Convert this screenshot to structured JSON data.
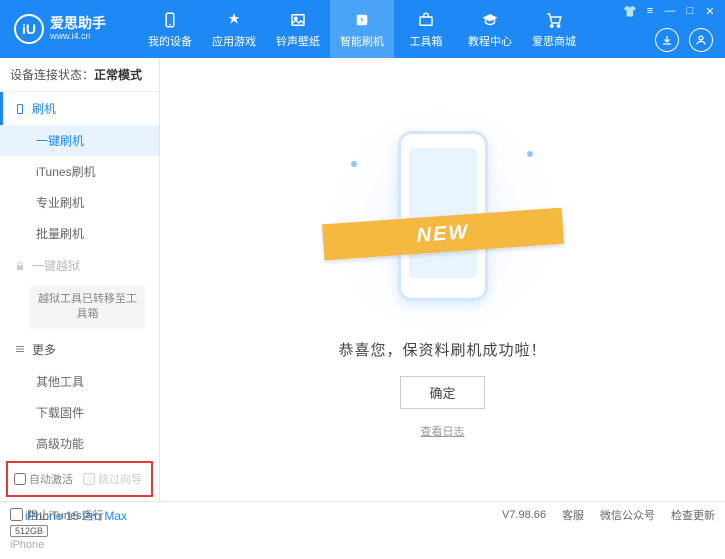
{
  "logo": {
    "mark": "iU",
    "title": "爱思助手",
    "subtitle": "www.i4.cn"
  },
  "nav": [
    {
      "label": "我的设备"
    },
    {
      "label": "应用游戏"
    },
    {
      "label": "铃声壁纸"
    },
    {
      "label": "智能刷机"
    },
    {
      "label": "工具箱"
    },
    {
      "label": "教程中心"
    },
    {
      "label": "爱思商城"
    }
  ],
  "status": {
    "prefix": "设备连接状态：",
    "value": "正常模式"
  },
  "sidebar": {
    "section_flash": "刷机",
    "items_flash": [
      "一键刷机",
      "iTunes刷机",
      "专业刷机",
      "批量刷机"
    ],
    "section_jailbreak": "一键越狱",
    "jailbreak_note": "越狱工具已转移至工具箱",
    "section_more": "更多",
    "items_more": [
      "其他工具",
      "下载固件",
      "高级功能"
    ]
  },
  "checkboxes": {
    "auto_activate": "自动激活",
    "skip_guide": "跳过向导"
  },
  "device": {
    "name": "iPhone 15 Pro Max",
    "storage": "512GB",
    "type": "iPhone"
  },
  "main": {
    "banner": "NEW",
    "success": "恭喜您，保资料刷机成功啦！",
    "ok": "确定",
    "view_log": "查看日志"
  },
  "footer": {
    "block_itunes": "阻止iTunes运行",
    "version": "V7.98.66",
    "links": [
      "客服",
      "微信公众号",
      "检查更新"
    ]
  }
}
